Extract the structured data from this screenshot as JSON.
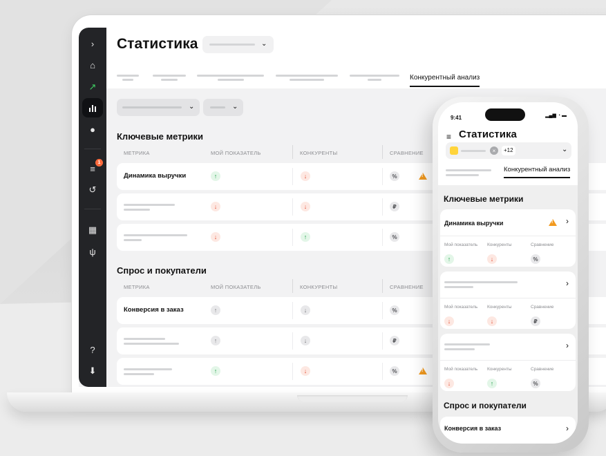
{
  "laptop": {
    "title": "Статистика",
    "active_tab": "Конкурентный анализ",
    "sidebar": {
      "items": [
        "chevron-right-icon",
        "home-icon",
        "trend-up-icon",
        "bar-chart-icon",
        "chat-icon",
        "stack-icon",
        "history-icon",
        "store-icon",
        "fork-knife-icon",
        "help-icon",
        "download-icon"
      ],
      "badge": "1"
    },
    "sections": [
      {
        "title": "Ключевые метрики",
        "columns": [
          "МЕТРИКА",
          "МОЙ ПОКАЗАТЕЛЬ",
          "КОНКУРЕНТЫ",
          "СРАВНЕНИЕ"
        ],
        "rows": [
          {
            "label": "Динамика выручки",
            "mine": "↑",
            "comp": "↓",
            "cmp": "%"
          },
          {
            "label": "",
            "mine": "↓",
            "comp": "↓",
            "cmp": "₽"
          },
          {
            "label": "",
            "mine": "↓",
            "comp": "↑",
            "cmp": "%"
          }
        ]
      },
      {
        "title": "Спрос и покупатели",
        "columns": [
          "МЕТРИКА",
          "МОЙ ПОКАЗАТЕЛЬ",
          "КОНКУРЕНТЫ",
          "СРАВНЕНИЕ"
        ],
        "rows": [
          {
            "label": "Конверсия в заказ",
            "mine": "↑",
            "comp": "↓",
            "cmp": "%"
          },
          {
            "label": "",
            "mine": "↑",
            "comp": "↓",
            "cmp": "₽"
          },
          {
            "label": "",
            "mine": "↑",
            "comp": "↓",
            "cmp": "%"
          }
        ]
      }
    ]
  },
  "phone": {
    "time": "9:41",
    "status_icons": "▂▄▆ ◔ ▬",
    "title": "Статистика",
    "plus_count": "+12",
    "active_tab": "Конкурентный анализ",
    "section1": "Ключевые метрики",
    "section2": "Спрос и покупатели",
    "col_labels": [
      "Мой показатель",
      "Конкуренты",
      "Сравнение"
    ],
    "cards": [
      {
        "title": "Динамика выручки",
        "mine": "↑",
        "comp": "↓",
        "cmp": "%"
      },
      {
        "title": "",
        "mine": "↓",
        "comp": "↓",
        "cmp": "₽"
      },
      {
        "title": "",
        "mine": "↓",
        "comp": "↑",
        "cmp": "%"
      }
    ],
    "card4_title": "Конверсия в заказ"
  }
}
